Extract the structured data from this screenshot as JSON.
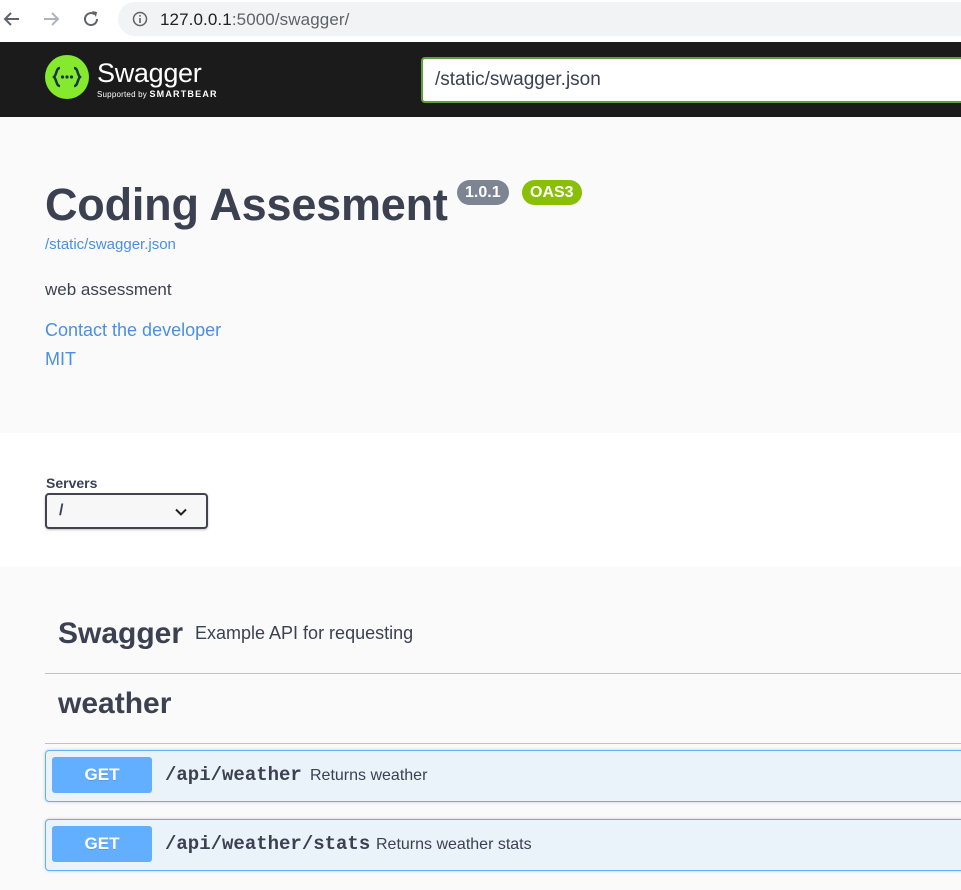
{
  "browser": {
    "url_host": "127.0.0.1",
    "url_path": ":5000/swagger/",
    "icons": [
      "back-arrow-icon",
      "forward-arrow-icon",
      "reload-icon",
      "info-icon"
    ]
  },
  "topbar": {
    "logo_title": "Swagger",
    "logo_supported_by": "Supported by",
    "logo_brand": "SMARTBEAR",
    "logo_symbol": "{···}",
    "spec_url": "/static/swagger.json"
  },
  "info": {
    "title": "Coding Assesment",
    "version": "1.0.1",
    "oas": "OAS3",
    "spec_link": "/static/swagger.json",
    "description": "web assessment",
    "contact": "Contact the developer",
    "license": "MIT"
  },
  "servers": {
    "label": "Servers",
    "selected": "/"
  },
  "tags": [
    {
      "name": "Swagger",
      "description": "Example API for requesting"
    },
    {
      "name": "weather",
      "description": ""
    }
  ],
  "operations": [
    {
      "method": "GET",
      "path": "/api/weather",
      "summary": "Returns weather"
    },
    {
      "method": "GET",
      "path": "/api/weather/stats",
      "summary": "Returns weather stats"
    }
  ],
  "colors": {
    "get": "#61affe",
    "topbar": "#1b1b1b",
    "logo": "#85ea2d",
    "oas_badge": "#89bf04",
    "version_badge": "#7d8492",
    "link": "#4990e2"
  }
}
